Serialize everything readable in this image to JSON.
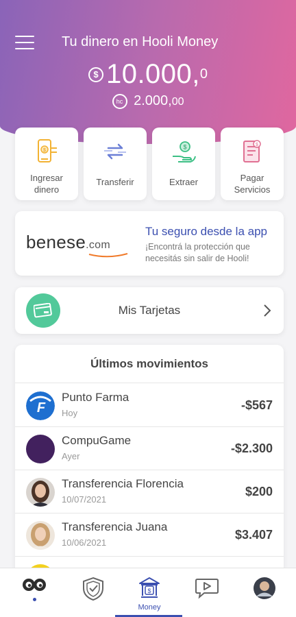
{
  "header": {
    "title": "Tu dinero en Hooli Money",
    "balance_amount": "10.000,",
    "balance_decimals": "0",
    "balance_symbol": "$",
    "hc_symbol": "hc",
    "hc_amount": "2.000,",
    "hc_decimals": "00"
  },
  "actions": [
    {
      "line1": "Ingresar",
      "line2": "dinero",
      "icon": "deposit-icon"
    },
    {
      "line1": "Transferir",
      "line2": "",
      "icon": "transfer-icon"
    },
    {
      "line1": "Extraer",
      "line2": "",
      "icon": "withdraw-icon"
    },
    {
      "line1": "Pagar",
      "line2": "Servicios",
      "icon": "bill-icon"
    }
  ],
  "promo": {
    "logo_main": "benese",
    "logo_suffix": ".com",
    "title": "Tu seguro desde la app",
    "description": "¡Encontrá la protección que necesitás sin salir de Hooli!"
  },
  "cards": {
    "label": "Mis Tarjetas"
  },
  "movements": {
    "title": "Últimos movimientos",
    "items": [
      {
        "name": "Punto Farma",
        "date": "Hoy",
        "amount": "-$567"
      },
      {
        "name": "CompuGame",
        "date": "Ayer",
        "amount": "-$2.300"
      },
      {
        "name": "Transferencia Florencia",
        "date": "10/07/2021",
        "amount": "$200"
      },
      {
        "name": "Transferencia Juana",
        "date": "10/06/2021",
        "amount": "$3.407"
      }
    ]
  },
  "nav": {
    "items": [
      {
        "icon": "hooli-eyes-icon",
        "label": ""
      },
      {
        "icon": "shield-icon",
        "label": ""
      },
      {
        "icon": "bank-icon",
        "label": "Money"
      },
      {
        "icon": "video-chat-icon",
        "label": ""
      },
      {
        "icon": "profile-avatar",
        "label": ""
      }
    ]
  },
  "colors": {
    "gradient_start": "#8a64b8",
    "gradient_end": "#e0679f",
    "accent_blue": "#3b4fb0",
    "cards_green": "#52c99a"
  }
}
